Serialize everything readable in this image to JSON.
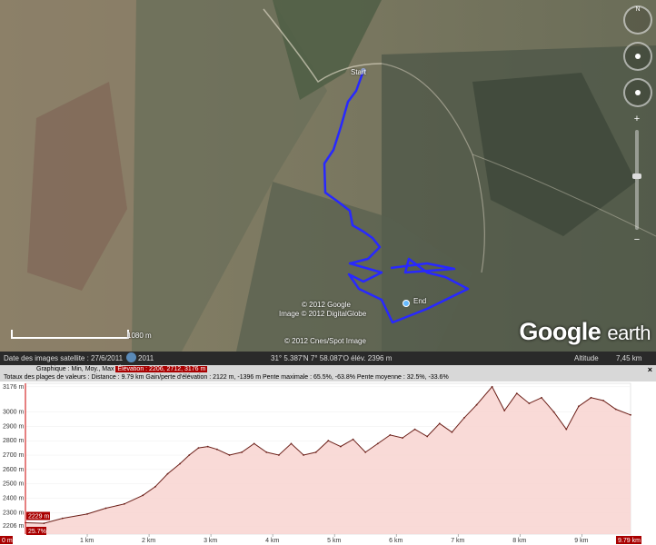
{
  "map": {
    "start_label": "Start",
    "end_label": "End",
    "copyright": [
      "© 2012 Google",
      "Image © 2012 DigitalGlobe",
      "© 2012 Cnes/Spot Image"
    ],
    "scale_label": "1080 m",
    "logo_google": "Google",
    "logo_earth": "earth",
    "nav": {
      "north": "N",
      "zoom_in": "+",
      "zoom_out": "−"
    }
  },
  "statusbar": {
    "image_date": "Date des images satellite : 27/6/2011",
    "year": "2011",
    "coords": "31° 5.387'N    7° 58.087'O élév. 2396 m",
    "altitude_label": "Altitude",
    "altitude_value": "7,45 km"
  },
  "profile": {
    "graph_line_prefix": "Graphique : Min, Moy., Max",
    "graph_line_values": "Élévation : 2206, 2712, 3176 m",
    "totals_line": "Totaux des plages de valeurs : Distance : 9.79 km    Gain/perte d'élévation : 2122 m, -1396 m   Pente maximale : 65.5%, -63.8%  Pente moyenne : 32.5%, -33.6%",
    "close": "×",
    "cursor_elev": "2229 m",
    "cursor_slope": "25.7%",
    "cursor_dist": "0 m",
    "end_dist": "9.79 km"
  },
  "chart_data": {
    "type": "area",
    "xlabel": "",
    "ylabel": "",
    "xlim": [
      0,
      9.79
    ],
    "ylim": [
      2150,
      3200
    ],
    "y_ticks": [
      {
        "v": 3176,
        "label": "3176 m"
      },
      {
        "v": 3000,
        "label": "3000 m"
      },
      {
        "v": 2900,
        "label": "2900 m"
      },
      {
        "v": 2800,
        "label": "2800 m"
      },
      {
        "v": 2700,
        "label": "2700 m"
      },
      {
        "v": 2600,
        "label": "2600 m"
      },
      {
        "v": 2500,
        "label": "2500 m"
      },
      {
        "v": 2400,
        "label": "2400 m"
      },
      {
        "v": 2300,
        "label": "2300 m"
      },
      {
        "v": 2206,
        "label": "2206 m"
      }
    ],
    "x_ticks": [
      {
        "v": 1,
        "label": "1 km"
      },
      {
        "v": 2,
        "label": "2 km"
      },
      {
        "v": 3,
        "label": "3 km"
      },
      {
        "v": 4,
        "label": "4 km"
      },
      {
        "v": 5,
        "label": "5 km"
      },
      {
        "v": 6,
        "label": "6 km"
      },
      {
        "v": 7,
        "label": "7 km"
      },
      {
        "v": 8,
        "label": "8 km"
      },
      {
        "v": 9,
        "label": "9 km"
      }
    ],
    "series": [
      {
        "x": [
          0,
          0.3,
          0.6,
          1.0,
          1.3,
          1.6,
          1.9,
          2.1,
          2.3,
          2.5,
          2.65,
          2.8,
          2.95,
          3.1,
          3.3,
          3.5,
          3.7,
          3.9,
          4.1,
          4.3,
          4.5,
          4.7,
          4.9,
          5.1,
          5.3,
          5.5,
          5.7,
          5.9,
          6.1,
          6.3,
          6.5,
          6.7,
          6.9,
          7.1,
          7.3,
          7.55,
          7.75,
          7.95,
          8.15,
          8.35,
          8.55,
          8.75,
          8.95,
          9.15,
          9.35,
          9.55,
          9.79
        ],
        "y": [
          2229,
          2225,
          2260,
          2290,
          2330,
          2360,
          2420,
          2480,
          2570,
          2640,
          2700,
          2750,
          2760,
          2740,
          2700,
          2720,
          2780,
          2720,
          2700,
          2780,
          2700,
          2720,
          2800,
          2760,
          2810,
          2720,
          2780,
          2840,
          2820,
          2880,
          2830,
          2920,
          2860,
          2960,
          3050,
          3176,
          3010,
          3130,
          3060,
          3100,
          3000,
          2880,
          3040,
          3100,
          3080,
          3020,
          2980
        ]
      }
    ]
  }
}
